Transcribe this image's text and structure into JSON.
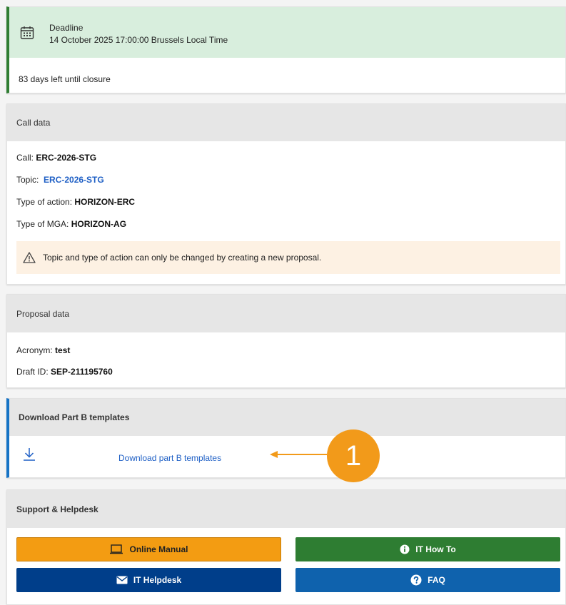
{
  "deadline": {
    "title": "Deadline",
    "date": "14 October 2025 17:00:00 Brussels Local Time",
    "days_left": "83 days left until closure",
    "accent_color": "#2f7d32",
    "icon": "calendar-icon"
  },
  "call_data": {
    "header": "Call data",
    "call_label": "Call:",
    "call_value": "ERC-2026-STG",
    "topic_label": "Topic:",
    "topic_value": "ERC-2026-STG",
    "action_label": "Type of action:",
    "action_value": "HORIZON-ERC",
    "mga_label": "Type of MGA:",
    "mga_value": "HORIZON-AG",
    "warning": "Topic and type of action can only be changed by creating a new proposal.",
    "warning_icon": "warning-icon"
  },
  "proposal_data": {
    "header": "Proposal data",
    "acronym_label": "Acronym:",
    "acronym_value": "test",
    "draft_label": "Draft ID:",
    "draft_value": "SEP-211195760"
  },
  "download": {
    "header": "Download Part B templates",
    "link_label": "Download part B templates",
    "icon": "download-icon",
    "accent_color": "#1673c5"
  },
  "support": {
    "header": "Support & Helpdesk",
    "buttons": {
      "manual": "Online Manual",
      "howto": "IT How To",
      "helpdesk": "IT Helpdesk",
      "faq": "FAQ"
    },
    "colors": {
      "manual": "#f39c12",
      "howto": "#2e7d32",
      "helpdesk": "#003e8a",
      "faq": "#0f62ad"
    }
  },
  "annotation": {
    "number": "1",
    "color": "#f29a1a"
  }
}
